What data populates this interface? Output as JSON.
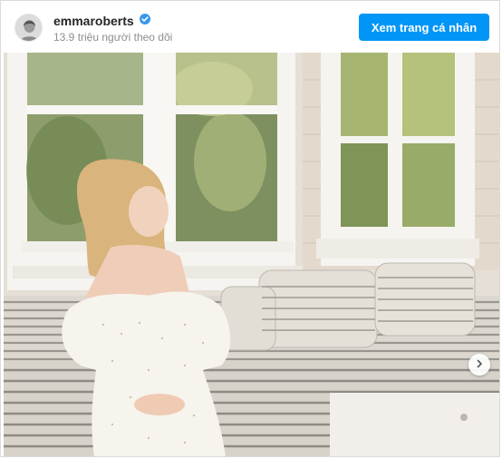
{
  "post": {
    "username": "emmaroberts",
    "verified": true,
    "followers_text": "13.9 triệu người theo dõi",
    "view_profile_label": "Xem trang cá nhân"
  },
  "icons": {
    "verified": "verified-badge-icon",
    "next": "chevron-right-icon"
  },
  "colors": {
    "accent": "#0095f6",
    "muted_text": "#8e8e8e",
    "primary_text": "#262626"
  }
}
